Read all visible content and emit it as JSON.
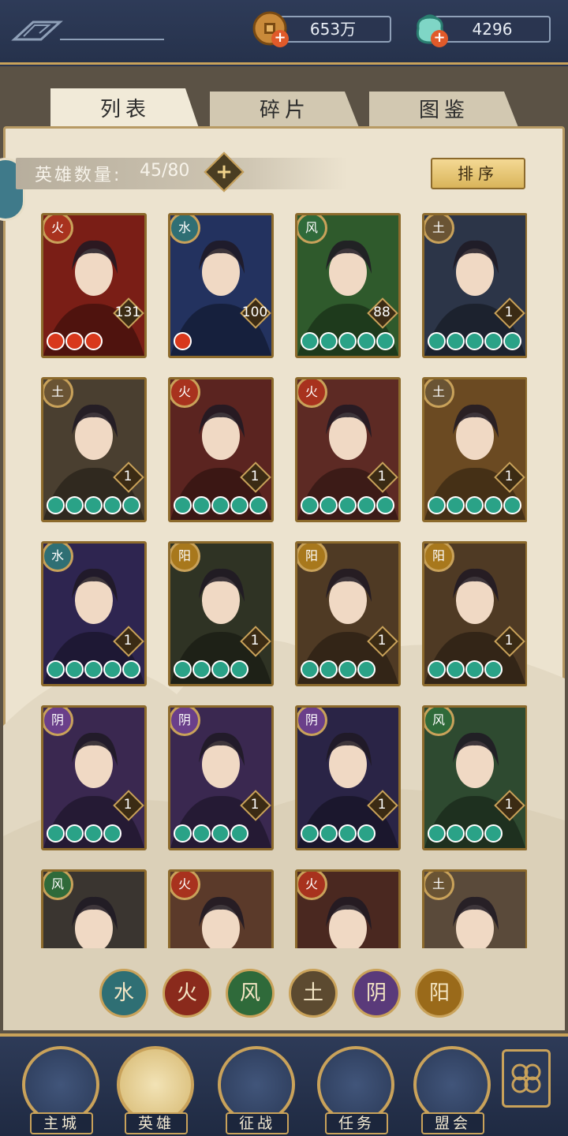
{
  "header": {
    "coins_value": "653万",
    "gems_value": "4296",
    "plus_symbol": "+"
  },
  "tabs": [
    {
      "label": "列表",
      "active": true
    },
    {
      "label": "碎片",
      "active": false
    },
    {
      "label": "图鉴",
      "active": false
    }
  ],
  "hero_count": {
    "label": "英雄数量:",
    "value": "45/80",
    "plus_symbol": "+"
  },
  "sort_label": "排序",
  "heroes": [
    {
      "element": "火",
      "level": "131",
      "stars": 3,
      "star_color": "red",
      "bg": "#7a1e16"
    },
    {
      "element": "水",
      "level": "100",
      "stars": 1,
      "star_color": "red",
      "bg": "#23325f"
    },
    {
      "element": "风",
      "level": "88",
      "stars": 5,
      "star_color": "teal",
      "bg": "#2f5a2c"
    },
    {
      "element": "土",
      "level": "1",
      "stars": 5,
      "star_color": "teal",
      "bg": "#2c3548"
    },
    {
      "element": "土",
      "level": "1",
      "stars": 5,
      "star_color": "teal",
      "bg": "#4a3f30"
    },
    {
      "element": "火",
      "level": "1",
      "stars": 5,
      "star_color": "teal",
      "bg": "#5b2420"
    },
    {
      "element": "火",
      "level": "1",
      "stars": 5,
      "star_color": "teal",
      "bg": "#5d2a24"
    },
    {
      "element": "土",
      "level": "1",
      "stars": 5,
      "star_color": "teal",
      "bg": "#6b4a22"
    },
    {
      "element": "水",
      "level": "1",
      "stars": 5,
      "star_color": "teal",
      "bg": "#2e2550"
    },
    {
      "element": "阳",
      "level": "1",
      "stars": 4,
      "star_color": "teal",
      "bg": "#2f3324"
    },
    {
      "element": "阳",
      "level": "1",
      "stars": 4,
      "star_color": "teal",
      "bg": "#4f3a24"
    },
    {
      "element": "阳",
      "level": "1",
      "stars": 4,
      "star_color": "teal",
      "bg": "#4f3a24"
    },
    {
      "element": "阴",
      "level": "1",
      "stars": 4,
      "star_color": "teal",
      "bg": "#3a2850"
    },
    {
      "element": "阴",
      "level": "1",
      "stars": 4,
      "star_color": "teal",
      "bg": "#3a2850"
    },
    {
      "element": "阴",
      "level": "1",
      "stars": 4,
      "star_color": "teal",
      "bg": "#2a2446"
    },
    {
      "element": "风",
      "level": "1",
      "stars": 4,
      "star_color": "teal",
      "bg": "#2e4a30"
    },
    {
      "element": "风",
      "level": "",
      "stars": 0,
      "star_color": "teal",
      "bg": "#3a3530"
    },
    {
      "element": "火",
      "level": "",
      "stars": 0,
      "star_color": "teal",
      "bg": "#5b3a2a"
    },
    {
      "element": "火",
      "level": "",
      "stars": 0,
      "star_color": "teal",
      "bg": "#4a2820"
    },
    {
      "element": "土",
      "level": "",
      "stars": 0,
      "star_color": "teal",
      "bg": "#5a4a3a"
    }
  ],
  "element_filters": [
    {
      "glyph": "水",
      "color": "#2f6f74"
    },
    {
      "glyph": "火",
      "color": "#8a2a1c"
    },
    {
      "glyph": "风",
      "color": "#2f6a3a"
    },
    {
      "glyph": "土",
      "color": "#5c4a30"
    },
    {
      "glyph": "阴",
      "color": "#5a3a7a"
    },
    {
      "glyph": "阳",
      "color": "#9a6a1a"
    }
  ],
  "nav": [
    {
      "label": "主城",
      "active": false
    },
    {
      "label": "英雄",
      "active": true
    },
    {
      "label": "征战",
      "active": false
    },
    {
      "label": "任务",
      "active": false
    },
    {
      "label": "盟会",
      "active": false
    }
  ],
  "colors": {
    "gold": "#c9a25a",
    "navy": "#2a3550",
    "parchment": "#ece3cf"
  }
}
